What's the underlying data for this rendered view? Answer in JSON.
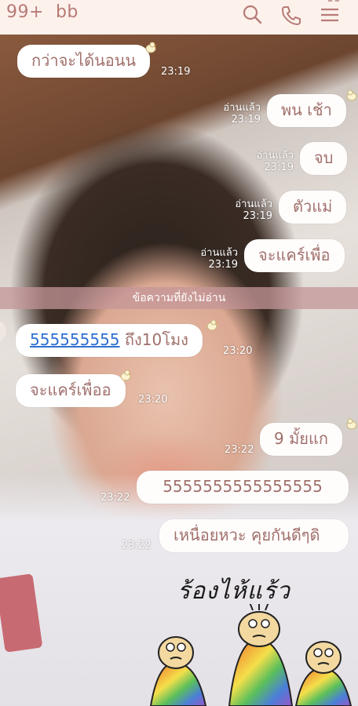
{
  "header": {
    "unread_count": "99+",
    "chat_name": "bb",
    "icons": [
      "search-icon",
      "phone-icon",
      "menu-icon"
    ]
  },
  "messages": [
    {
      "side": "left",
      "text": "กว่าจะได้นอนน",
      "time": "23:19"
    },
    {
      "side": "right",
      "text": "พน เช้า",
      "read": "อ่านแล้ว",
      "time": "23:19"
    },
    {
      "side": "right",
      "text": "จบ",
      "read": "อ่านแล้ว",
      "time": "23:19"
    },
    {
      "side": "right",
      "text": "ตัวแม่",
      "read": "อ่านแล้ว",
      "time": "23:19"
    },
    {
      "side": "right",
      "text": "จะแคร์เพื่อ",
      "read": "อ่านแล้ว",
      "time": "23:19"
    },
    {
      "side": "left",
      "link": "555555555",
      "text": " ถึง10โมง",
      "time": "23:20"
    },
    {
      "side": "left",
      "text": "จะแคร์เพื่ออ",
      "time": "23:20"
    },
    {
      "side": "right",
      "text": "9 มั้ยแก",
      "time": "23:22"
    },
    {
      "side": "right",
      "text": "5555555555555555",
      "time": "23:22"
    },
    {
      "side": "right",
      "text": "เหนื่อยหวะ คุยกันดีๆดิ",
      "time": "23:22"
    }
  ],
  "unread_divider": "ข้อความที่ยังไม่อ่าน",
  "sticker": {
    "caption": "ร้องไห้แร้ว"
  },
  "colors": {
    "header_bg": "#fdf1ec",
    "accent": "#b77b76",
    "bubble_text": "#a0706c",
    "link": "#2f6fd1"
  }
}
